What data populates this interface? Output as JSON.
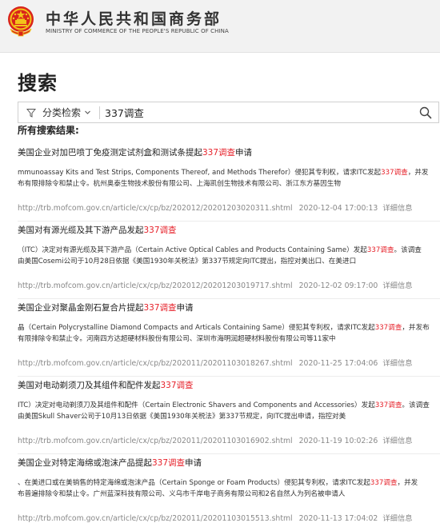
{
  "header": {
    "title_cn": "中华人民共和国商务部",
    "title_en": "MINISTRY OF COMMERCE OF THE PEOPLE'S REPUBLIC OF CHINA",
    "emblem_icon": "national-emblem-icon"
  },
  "page": {
    "title": "搜索"
  },
  "search": {
    "filter_label": "分类检索",
    "query": "337调查",
    "placeholder": "",
    "icons": {
      "filter": "filter-icon",
      "chevron": "chevron-down-icon",
      "search": "search-icon"
    }
  },
  "results_heading": "所有搜索结果:",
  "colors": {
    "highlight": "#e6212a",
    "meta": "#888888"
  },
  "results": [
    {
      "title_pre": "美国企业对加巴喷丁免疫测定试剂盒和测试条提起",
      "title_hl": "337调查",
      "title_post": "申请",
      "line1_pre": "mmunoassay Kits and Test Strips, Components Thereof, and Methods Therefor）侵犯其专利权，请求ITC发起",
      "line1_hl": "337调查",
      "line1_post": "，并发",
      "line2": "布有限排除令和禁止令。杭州奥泰生物技术股份有限公司、上海凯创生物技术有限公司、浙江东方基因生物",
      "url": "http://trb.mofcom.gov.cn/article/cx/cp/bz/202012/20201203020311.shtml",
      "date": "2020-12-04 17:00:13",
      "detail": "详细信息"
    },
    {
      "title_pre": "美国对有源光缆及其下游产品发起",
      "title_hl": "337调查",
      "title_post": "",
      "line1_pre": "（ITC）决定对有源光缆及其下游产品（Certain Active Optical Cables and Products Containing Same）发起",
      "line1_hl": "337调查",
      "line1_post": "。该调查",
      "line2": "由美国Cosemi公司于10月28日依据《美国1930年关税法》第337节规定向ITC提出，指控对美出口、在美进口",
      "url": "http://trb.mofcom.gov.cn/article/cx/cp/bz/202012/20201203019717.shtml",
      "date": "2020-12-02 09:17:00",
      "detail": "详细信息"
    },
    {
      "title_pre": "美国企业对聚晶金刚石复合片提起",
      "title_hl": "337调查",
      "title_post": "申请",
      "line1_pre": "晶（Certain Polycrystalline Diamond Compacts and Articals Containing Same）侵犯其专利权，请求ITC发起",
      "line1_hl": "337调查",
      "line1_post": "，并发布",
      "line2": "有限排除令和禁止令。河南四方达超硬材料股份有限公司、深圳市海明润超硬材料股份有限公司等11家中",
      "url": "http://trb.mofcom.gov.cn/article/cx/cp/bz/202011/20201103018267.shtml",
      "date": "2020-11-25 17:04:06",
      "detail": "详细信息"
    },
    {
      "title_pre": "美国对电动剃须刀及其组件和配件发起",
      "title_hl": "337调查",
      "title_post": "",
      "line1_pre": "ITC）决定对电动剃须刀及其组件和配件（Certain Electronic Shavers and Components and Accessories）发起",
      "line1_hl": "337调查",
      "line1_post": "。该调查",
      "line2": "由美国Skull Shaver公司于10月13日依据《美国1930年关税法》第337节规定，向ITC提出申请，指控对美",
      "url": "http://trb.mofcom.gov.cn/article/cx/cp/bz/202011/20201103016902.shtml",
      "date": "2020-11-19 10:02:26",
      "detail": "详细信息"
    },
    {
      "title_pre": "美国企业对特定海绵或泡沫产品提起",
      "title_hl": "337调查",
      "title_post": "申请",
      "line1_pre": "、在美进口或在美销售的特定海绵或泡沫产品（Certain Sponge or Foam Products）侵犯其专利权，请求ITC发起",
      "line1_hl": "337调查",
      "line1_post": "，并发",
      "line2": "布普遍排除令和禁止令。广州蓝深科技有限公司、义乌市千岸电子商务有限公司和2名自然人为列名被申请人",
      "url": "http://trb.mofcom.gov.cn/article/cx/cp/bz/202011/20201103015513.shtml",
      "date": "2020-11-13 17:04:02",
      "detail": "详细信息"
    }
  ]
}
